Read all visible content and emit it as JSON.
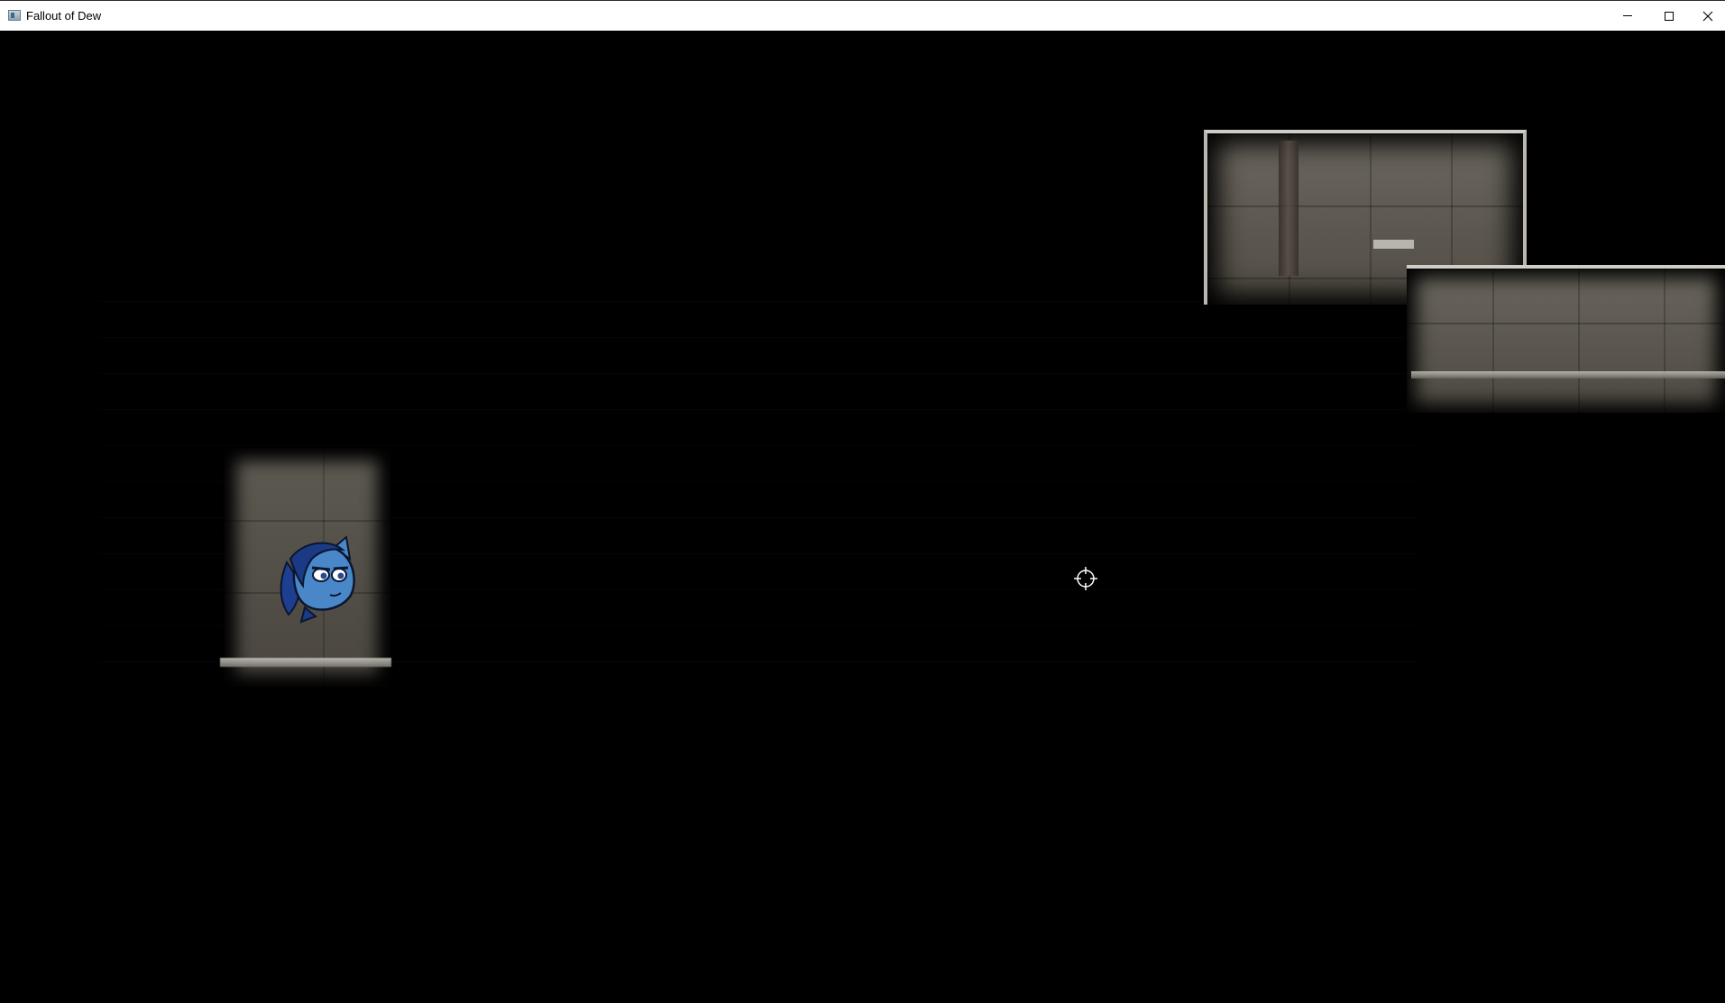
{
  "window": {
    "title": "Fallout of Dew",
    "icon": "app-icon",
    "controls": {
      "minimize_icon": "minimize-icon",
      "maximize_icon": "maximize-icon",
      "close_icon": "close-icon"
    }
  },
  "game": {
    "background_color": "#000000",
    "player_icon": "pony-head-icon",
    "player_color": "#4a87c9",
    "cursor_icon": "crosshair-icon"
  }
}
